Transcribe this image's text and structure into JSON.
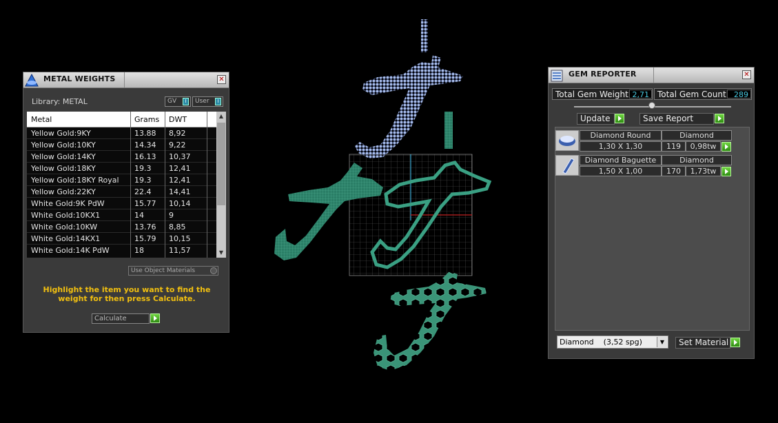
{
  "metal_panel": {
    "title": "METAL WEIGHTS",
    "library_label": "Library: METAL",
    "toggle_gv": "GV",
    "toggle_user": "User",
    "columns": [
      "Metal",
      "Grams",
      "DWT"
    ],
    "rows": [
      {
        "metal": "Yellow Gold:9KY",
        "grams": "13.88",
        "dwt": "8,92"
      },
      {
        "metal": "Yellow Gold:10KY",
        "grams": "14.34",
        "dwt": "9,22"
      },
      {
        "metal": "Yellow Gold:14KY",
        "grams": "16.13",
        "dwt": "10,37"
      },
      {
        "metal": "Yellow Gold:18KY",
        "grams": "19.3",
        "dwt": "12,41"
      },
      {
        "metal": "Yellow Gold:18KY Royal",
        "grams": "19.3",
        "dwt": "12,41"
      },
      {
        "metal": "Yellow Gold:22KY",
        "grams": "22.4",
        "dwt": "14,41"
      },
      {
        "metal": "White Gold:9K PdW",
        "grams": "15.77",
        "dwt": "10,14"
      },
      {
        "metal": "White Gold:10KX1",
        "grams": "14",
        "dwt": "9"
      },
      {
        "metal": "White Gold:10KW",
        "grams": "13.76",
        "dwt": "8,85"
      },
      {
        "metal": "White Gold:14KX1",
        "grams": "15.79",
        "dwt": "10,15"
      },
      {
        "metal": "White Gold:14K PdW",
        "grams": "18",
        "dwt": "11,57"
      }
    ],
    "use_object_materials": "Use Object Materials",
    "instruction": "Highlight the item you want to find the weight for then press Calculate.",
    "calculate_label": "Calculate"
  },
  "gem_panel": {
    "title": "GEM REPORTER",
    "total_weight_label": "Total Gem Weight",
    "total_weight_value": "2,71",
    "total_count_label": "Total Gem Count",
    "total_count_value": "289",
    "update_label": "Update",
    "save_report_label": "Save Report",
    "gems": [
      {
        "name": "Diamond Round",
        "material": "Diamond",
        "size": "1,30 X 1,30",
        "count": "119",
        "weight": "0,98tw"
      },
      {
        "name": "Diamond Baguette",
        "material": "Diamond",
        "size": "1,50 X 1,00",
        "count": "170",
        "weight": "1,73tw"
      }
    ],
    "material_select": "Diamond    (3,52 spg)",
    "set_material_label": "Set Material"
  },
  "colors": {
    "accent_green": "#3fae1f",
    "value_cyan": "#49c8df",
    "instruction_yellow": "#f2c010",
    "model_green": "#2f8a6e",
    "model_blue": "#9fb4e8"
  }
}
